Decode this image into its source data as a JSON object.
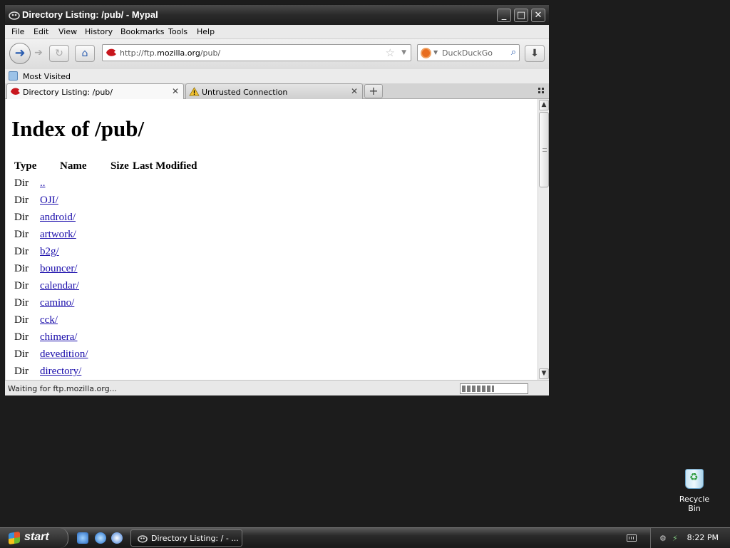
{
  "window": {
    "title": "Directory Listing: /pub/ - Mypal",
    "controls": {
      "minimize": "_",
      "maximize": "□",
      "close": "✕"
    }
  },
  "menu": {
    "items": [
      {
        "label": "File"
      },
      {
        "label": "Edit"
      },
      {
        "label": "View"
      },
      {
        "label": "History"
      },
      {
        "label": "Bookmarks"
      },
      {
        "label": "Tools"
      },
      {
        "label": "Help"
      }
    ]
  },
  "navbar": {
    "url_prefix": "http://ftp.",
    "url_domain": "mozilla.org",
    "url_path": "/pub/",
    "search_placeholder": "DuckDuckGo"
  },
  "bookmarks": {
    "items": [
      {
        "label": "Most Visited"
      }
    ]
  },
  "tabs": [
    {
      "label": "Directory Listing: /pub/",
      "active": true
    },
    {
      "label": "Untrusted Connection",
      "active": false
    }
  ],
  "page": {
    "heading": "Index of /pub/",
    "columns": {
      "type": "Type",
      "name": "Name",
      "size": "Size",
      "modified": "Last Modified"
    },
    "rows": [
      {
        "type": "Dir",
        "name": ".."
      },
      {
        "type": "Dir",
        "name": "OJI/"
      },
      {
        "type": "Dir",
        "name": "android/"
      },
      {
        "type": "Dir",
        "name": "artwork/"
      },
      {
        "type": "Dir",
        "name": "b2g/"
      },
      {
        "type": "Dir",
        "name": "bouncer/"
      },
      {
        "type": "Dir",
        "name": "calendar/"
      },
      {
        "type": "Dir",
        "name": "camino/"
      },
      {
        "type": "Dir",
        "name": "cck/"
      },
      {
        "type": "Dir",
        "name": "chimera/"
      },
      {
        "type": "Dir",
        "name": "devedition/"
      },
      {
        "type": "Dir",
        "name": "directory/"
      }
    ]
  },
  "status": {
    "text": "Waiting for ftp.mozilla.org...",
    "progress": 0.5
  },
  "desktop": {
    "icons": [
      {
        "label": "Recycle Bin"
      }
    ]
  },
  "taskbar": {
    "start_label": "start",
    "task_label": "Directory Listing: / - ...",
    "clock": "8:22 PM"
  }
}
